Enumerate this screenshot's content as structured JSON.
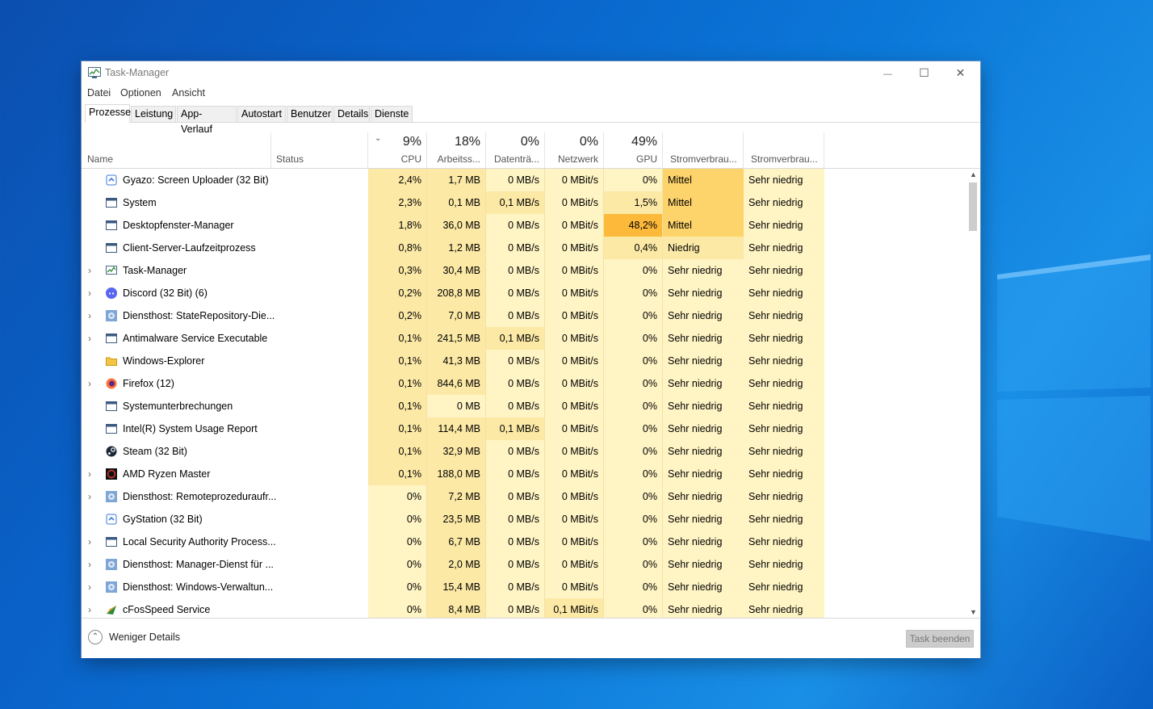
{
  "window": {
    "title": "Task-Manager",
    "minimize": "—",
    "maximize": "☐",
    "close": "✕"
  },
  "menu": [
    {
      "label": "Datei"
    },
    {
      "label": "Optionen"
    },
    {
      "label": "Ansicht"
    }
  ],
  "tabs": [
    {
      "label": "Prozesse",
      "active": true
    },
    {
      "label": "Leistung"
    },
    {
      "label": "App-Verlauf"
    },
    {
      "label": "Autostart"
    },
    {
      "label": "Benutzer"
    },
    {
      "label": "Details"
    },
    {
      "label": "Dienste"
    }
  ],
  "columns": {
    "name": "Name",
    "status": "Status",
    "cpu": {
      "pct": "9%",
      "label": "CPU"
    },
    "mem": {
      "pct": "18%",
      "label": "Arbeitss..."
    },
    "disk": {
      "pct": "0%",
      "label": "Datenträ..."
    },
    "net": {
      "pct": "0%",
      "label": "Netzwerk"
    },
    "gpu": {
      "pct": "49%",
      "label": "GPU"
    },
    "power": "Stromverbrau...",
    "power_trend": "Stromverbrau..."
  },
  "colors": {
    "heat_base": "#fff4c4",
    "heat_light": "#fce9a6",
    "heat_medium": "#fdd36b",
    "heat_high": "#fcb93a",
    "selection_header": "#ffffff",
    "accent": "#0a63c9"
  },
  "processes": [
    {
      "name": "Gyazo: Screen Uploader (32 Bit)",
      "icon": "gyazo-icon",
      "expand": false,
      "cpu": "2,4%",
      "mem": "1,7 MB",
      "disk": "0 MB/s",
      "net": "0 MBit/s",
      "gpu": "0%",
      "power": "Mittel",
      "power_trend": "Sehr niedrig"
    },
    {
      "name": "System",
      "icon": "system-icon",
      "expand": false,
      "cpu": "2,3%",
      "mem": "0,1 MB",
      "disk": "0,1 MB/s",
      "net": "0 MBit/s",
      "gpu": "1,5%",
      "power": "Mittel",
      "power_trend": "Sehr niedrig"
    },
    {
      "name": "Desktopfenster-Manager",
      "icon": "window-icon",
      "expand": false,
      "cpu": "1,8%",
      "mem": "36,0 MB",
      "disk": "0 MB/s",
      "net": "0 MBit/s",
      "gpu": "48,2%",
      "power": "Mittel",
      "power_trend": "Sehr niedrig"
    },
    {
      "name": "Client-Server-Laufzeitprozess",
      "icon": "window-icon",
      "expand": false,
      "cpu": "0,8%",
      "mem": "1,2 MB",
      "disk": "0 MB/s",
      "net": "0 MBit/s",
      "gpu": "0,4%",
      "power": "Niedrig",
      "power_trend": "Sehr niedrig"
    },
    {
      "name": "Task-Manager",
      "icon": "taskmanager-icon",
      "expand": true,
      "cpu": "0,3%",
      "mem": "30,4 MB",
      "disk": "0 MB/s",
      "net": "0 MBit/s",
      "gpu": "0%",
      "power": "Sehr niedrig",
      "power_trend": "Sehr niedrig"
    },
    {
      "name": "Discord (32 Bit) (6)",
      "icon": "discord-icon",
      "expand": true,
      "cpu": "0,2%",
      "mem": "208,8 MB",
      "disk": "0 MB/s",
      "net": "0 MBit/s",
      "gpu": "0%",
      "power": "Sehr niedrig",
      "power_trend": "Sehr niedrig"
    },
    {
      "name": "Diensthost: StateRepository-Die...",
      "icon": "gear-icon",
      "expand": true,
      "cpu": "0,2%",
      "mem": "7,0 MB",
      "disk": "0 MB/s",
      "net": "0 MBit/s",
      "gpu": "0%",
      "power": "Sehr niedrig",
      "power_trend": "Sehr niedrig"
    },
    {
      "name": "Antimalware Service Executable",
      "icon": "window-icon",
      "expand": true,
      "cpu": "0,1%",
      "mem": "241,5 MB",
      "disk": "0,1 MB/s",
      "net": "0 MBit/s",
      "gpu": "0%",
      "power": "Sehr niedrig",
      "power_trend": "Sehr niedrig"
    },
    {
      "name": "Windows-Explorer",
      "icon": "folder-icon",
      "expand": false,
      "cpu": "0,1%",
      "mem": "41,3 MB",
      "disk": "0 MB/s",
      "net": "0 MBit/s",
      "gpu": "0%",
      "power": "Sehr niedrig",
      "power_trend": "Sehr niedrig"
    },
    {
      "name": "Firefox (12)",
      "icon": "firefox-icon",
      "expand": true,
      "cpu": "0,1%",
      "mem": "844,6 MB",
      "disk": "0 MB/s",
      "net": "0 MBit/s",
      "gpu": "0%",
      "power": "Sehr niedrig",
      "power_trend": "Sehr niedrig"
    },
    {
      "name": "Systemunterbrechungen",
      "icon": "window-icon",
      "expand": false,
      "cpu": "0,1%",
      "mem": "0 MB",
      "disk": "0 MB/s",
      "net": "0 MBit/s",
      "gpu": "0%",
      "power": "Sehr niedrig",
      "power_trend": "Sehr niedrig"
    },
    {
      "name": "Intel(R) System Usage Report",
      "icon": "window-icon",
      "expand": false,
      "cpu": "0,1%",
      "mem": "114,4 MB",
      "disk": "0,1 MB/s",
      "net": "0 MBit/s",
      "gpu": "0%",
      "power": "Sehr niedrig",
      "power_trend": "Sehr niedrig"
    },
    {
      "name": "Steam (32 Bit)",
      "icon": "steam-icon",
      "expand": false,
      "cpu": "0,1%",
      "mem": "32,9 MB",
      "disk": "0 MB/s",
      "net": "0 MBit/s",
      "gpu": "0%",
      "power": "Sehr niedrig",
      "power_trend": "Sehr niedrig"
    },
    {
      "name": "AMD Ryzen Master",
      "icon": "amd-icon",
      "expand": true,
      "cpu": "0,1%",
      "mem": "188,0 MB",
      "disk": "0 MB/s",
      "net": "0 MBit/s",
      "gpu": "0%",
      "power": "Sehr niedrig",
      "power_trend": "Sehr niedrig"
    },
    {
      "name": "Diensthost: Remoteprozeduraufr...",
      "icon": "gear-icon",
      "expand": true,
      "cpu": "0%",
      "mem": "7,2 MB",
      "disk": "0 MB/s",
      "net": "0 MBit/s",
      "gpu": "0%",
      "power": "Sehr niedrig",
      "power_trend": "Sehr niedrig"
    },
    {
      "name": "GyStation (32 Bit)",
      "icon": "gyazo-icon",
      "expand": false,
      "cpu": "0%",
      "mem": "23,5 MB",
      "disk": "0 MB/s",
      "net": "0 MBit/s",
      "gpu": "0%",
      "power": "Sehr niedrig",
      "power_trend": "Sehr niedrig"
    },
    {
      "name": "Local Security Authority Process...",
      "icon": "window-icon",
      "expand": true,
      "cpu": "0%",
      "mem": "6,7 MB",
      "disk": "0 MB/s",
      "net": "0 MBit/s",
      "gpu": "0%",
      "power": "Sehr niedrig",
      "power_trend": "Sehr niedrig"
    },
    {
      "name": "Diensthost: Manager-Dienst für ...",
      "icon": "gear-icon",
      "expand": true,
      "cpu": "0%",
      "mem": "2,0 MB",
      "disk": "0 MB/s",
      "net": "0 MBit/s",
      "gpu": "0%",
      "power": "Sehr niedrig",
      "power_trend": "Sehr niedrig"
    },
    {
      "name": "Diensthost: Windows-Verwaltun...",
      "icon": "gear-icon",
      "expand": true,
      "cpu": "0%",
      "mem": "15,4 MB",
      "disk": "0 MB/s",
      "net": "0 MBit/s",
      "gpu": "0%",
      "power": "Sehr niedrig",
      "power_trend": "Sehr niedrig"
    },
    {
      "name": "cFosSpeed Service",
      "icon": "cfos-icon",
      "expand": true,
      "cpu": "0%",
      "mem": "8,4 MB",
      "disk": "0 MB/s",
      "net": "0,1 MBit/s",
      "gpu": "0%",
      "power": "Sehr niedrig",
      "power_trend": "Sehr niedrig"
    }
  ],
  "footer": {
    "fewer_details": "Weniger Details",
    "end_task": "Task beenden"
  }
}
